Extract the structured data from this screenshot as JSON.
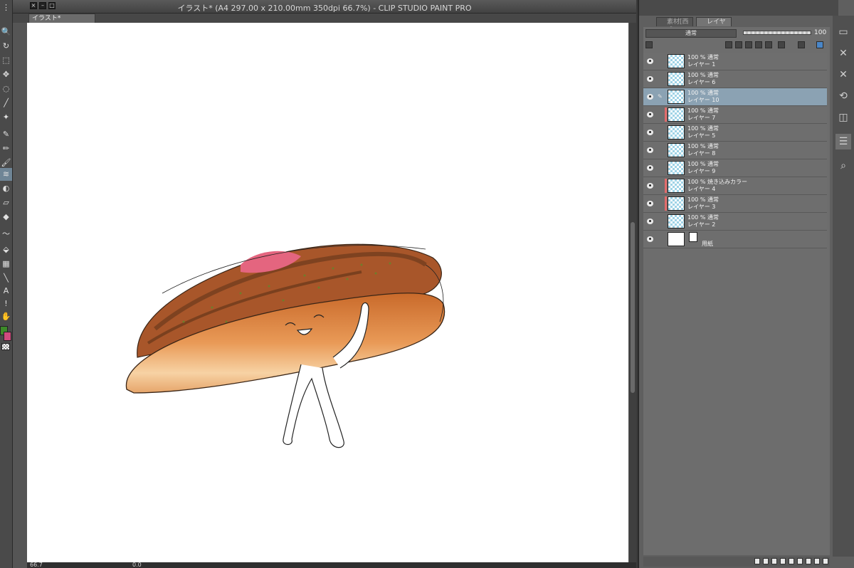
{
  "window": {
    "title": "イラスト* (A4 297.00 x 210.00mm 350dpi 66.7%)  - CLIP STUDIO PAINT PRO",
    "doc_tab": "イラスト*"
  },
  "toolbar": {
    "tools": [
      "zoom-icon",
      "move-icon",
      "select-icon",
      "pen-icon",
      "brush-icon",
      "eraser-icon",
      "fill-icon",
      "gradient-icon",
      "text-icon",
      "line-icon"
    ],
    "text_tool_label": "A",
    "main_color": "#3d8a2a",
    "sub_color": "#d04a7e"
  },
  "status": {
    "zoom": "66.7",
    "rotate": "0.0"
  },
  "panel": {
    "tabs": [
      "素材[西成]",
      "レイヤー"
    ],
    "blend_mode": "通常",
    "opacity": "100",
    "layers": [
      {
        "mode": "100 % 通常",
        "name": "レイヤー 1",
        "selected": false,
        "clip": false
      },
      {
        "mode": "100 % 通常",
        "name": "レイヤー 6",
        "selected": false,
        "clip": false
      },
      {
        "mode": "100 % 通常",
        "name": "レイヤー 10",
        "selected": true,
        "clip": false
      },
      {
        "mode": "100 % 通常",
        "name": "レイヤー 7",
        "selected": false,
        "clip": true
      },
      {
        "mode": "100 % 通常",
        "name": "レイヤー 5",
        "selected": false,
        "clip": false
      },
      {
        "mode": "100 % 通常",
        "name": "レイヤー 8",
        "selected": false,
        "clip": false
      },
      {
        "mode": "100 % 通常",
        "name": "レイヤー 9",
        "selected": false,
        "clip": false
      },
      {
        "mode": "100 % 焼き込みカラー",
        "name": "レイヤー 4",
        "selected": false,
        "clip": true
      },
      {
        "mode": "100 % 通常",
        "name": "レイヤー 3",
        "selected": false,
        "clip": true
      },
      {
        "mode": "100 % 通常",
        "name": "レイヤー 2",
        "selected": false,
        "clip": false
      }
    ],
    "paper_label": "用紙"
  },
  "colors": {
    "selection": "#8ba2b3",
    "clip_indicator": "#e26a6a"
  }
}
